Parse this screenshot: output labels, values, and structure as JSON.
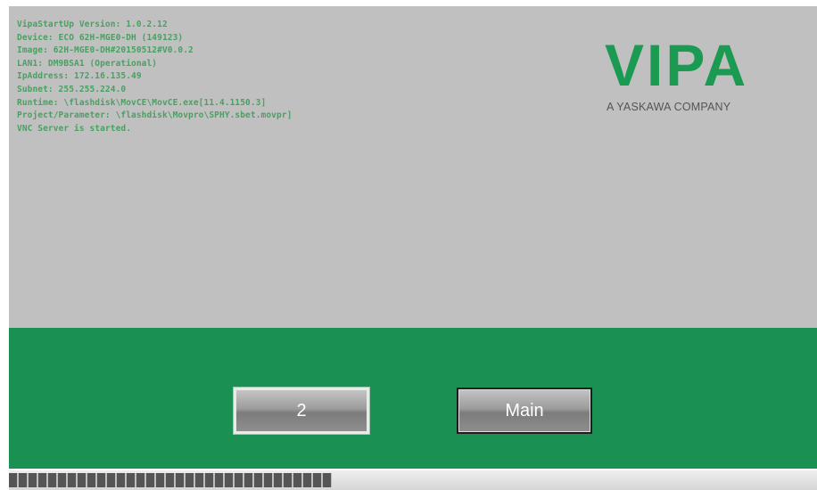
{
  "boot_log": [
    "VipaStartUp Version: 1.0.2.12",
    "Device: ECO 62H-MGE0-DH (149123)",
    "Image: 62H-MGE0-DH#20150512#V0.0.2",
    "LAN1: DM9BSA1 (Operational)",
    "IpAddress: 172.16.135.49",
    "Subnet: 255.255.224.0",
    "Runtime: \\flashdisk\\MovCE\\MovCE.exe[11.4.1150.3]",
    "Project/Parameter: \\flashdisk\\Movpro\\SPHY.sbet.movpr]",
    "VNC Server is started."
  ],
  "logo": {
    "word": "VIPA",
    "tagline": "A YASKAWA COMPANY"
  },
  "buttons": {
    "two": "2",
    "main": "Main"
  },
  "progress": {
    "fraction": 0.4
  },
  "colors": {
    "panel_gray": "#c0c0c0",
    "brand_green": "#1b9053",
    "log_green": "#2f9a4d"
  }
}
